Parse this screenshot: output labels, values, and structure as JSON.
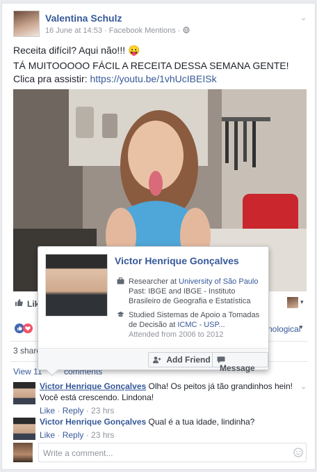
{
  "post": {
    "author": "Valentina Schulz",
    "date": "16 June at 14:53",
    "app": "Facebook Mentions",
    "line1": "Receita difícil? Aqui não!!!",
    "emoji": "😛",
    "line2a": "TÁ MUITOOOOO FÁCIL A RECEITA DESSA SEMANA GENTE! Clica pra assistir: ",
    "link": "https://youtu.be/1vhUcIBEISk"
  },
  "actions": {
    "like": "Like"
  },
  "reactions": {
    "text": "nological"
  },
  "shares": {
    "text": "3 share"
  },
  "comments_link": {
    "left": "View 11",
    "right": "comments"
  },
  "comments": [
    {
      "author": "Victor Henrique Gonçalves",
      "text": "Olha! Os peitos já tão grandinhos hein! Você está crescendo. Lindona!",
      "like": "Like",
      "reply": "Reply",
      "time": "23 hrs"
    },
    {
      "author": "Victor Henrique Gonçalves",
      "text": "Qual é a tua idade, lindinha?",
      "like": "Like",
      "reply": "Reply",
      "time": "23 hrs"
    }
  ],
  "write": {
    "placeholder": "Write a comment..."
  },
  "hovercard": {
    "name": "Victor Henrique Gonçalves",
    "work_prefix": "Researcher at ",
    "work_link": "University of São Paulo",
    "work_past": "Past: IBGE and IBGE - Instituto Brasileiro de Geografia e Estatística",
    "study_prefix": "Studied Sistemas de Apoio a Tomadas de Decisão at ",
    "study_link": "ICMC - USP...",
    "study_years": "Attended from 2006 to 2012",
    "add_friend": "Add Friend",
    "message": "Message"
  },
  "colors": {
    "link": "#365899",
    "like_blue": "#4267b2",
    "love_red": "#f25268"
  },
  "icons": [
    "chevron-down-icon",
    "globe-icon",
    "like-thumb-icon",
    "love-heart-icon",
    "briefcase-icon",
    "graduation-cap-icon",
    "add-friend-icon",
    "message-icon",
    "emoji-icon"
  ]
}
